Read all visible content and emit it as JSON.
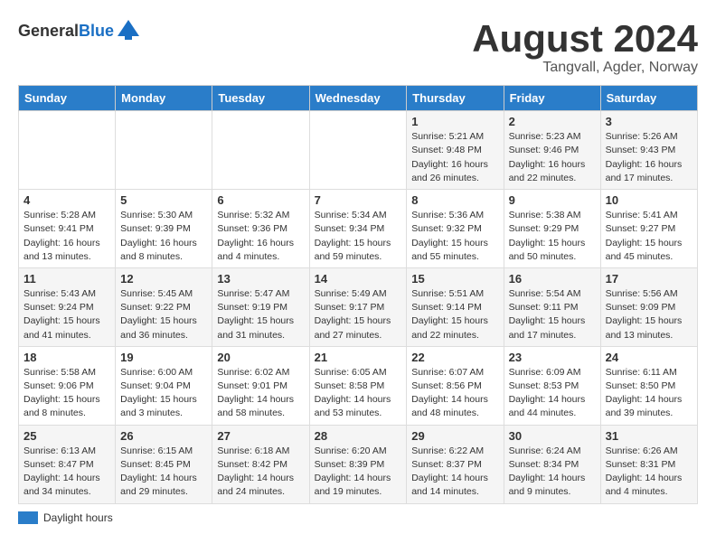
{
  "header": {
    "logo_general": "General",
    "logo_blue": "Blue",
    "title": "August 2024",
    "subtitle": "Tangvall, Agder, Norway"
  },
  "weekdays": [
    "Sunday",
    "Monday",
    "Tuesday",
    "Wednesday",
    "Thursday",
    "Friday",
    "Saturday"
  ],
  "legend": {
    "label": "Daylight hours"
  },
  "weeks": [
    [
      {
        "day": "",
        "info": ""
      },
      {
        "day": "",
        "info": ""
      },
      {
        "day": "",
        "info": ""
      },
      {
        "day": "",
        "info": ""
      },
      {
        "day": "1",
        "info": "Sunrise: 5:21 AM\nSunset: 9:48 PM\nDaylight: 16 hours\nand 26 minutes."
      },
      {
        "day": "2",
        "info": "Sunrise: 5:23 AM\nSunset: 9:46 PM\nDaylight: 16 hours\nand 22 minutes."
      },
      {
        "day": "3",
        "info": "Sunrise: 5:26 AM\nSunset: 9:43 PM\nDaylight: 16 hours\nand 17 minutes."
      }
    ],
    [
      {
        "day": "4",
        "info": "Sunrise: 5:28 AM\nSunset: 9:41 PM\nDaylight: 16 hours\nand 13 minutes."
      },
      {
        "day": "5",
        "info": "Sunrise: 5:30 AM\nSunset: 9:39 PM\nDaylight: 16 hours\nand 8 minutes."
      },
      {
        "day": "6",
        "info": "Sunrise: 5:32 AM\nSunset: 9:36 PM\nDaylight: 16 hours\nand 4 minutes."
      },
      {
        "day": "7",
        "info": "Sunrise: 5:34 AM\nSunset: 9:34 PM\nDaylight: 15 hours\nand 59 minutes."
      },
      {
        "day": "8",
        "info": "Sunrise: 5:36 AM\nSunset: 9:32 PM\nDaylight: 15 hours\nand 55 minutes."
      },
      {
        "day": "9",
        "info": "Sunrise: 5:38 AM\nSunset: 9:29 PM\nDaylight: 15 hours\nand 50 minutes."
      },
      {
        "day": "10",
        "info": "Sunrise: 5:41 AM\nSunset: 9:27 PM\nDaylight: 15 hours\nand 45 minutes."
      }
    ],
    [
      {
        "day": "11",
        "info": "Sunrise: 5:43 AM\nSunset: 9:24 PM\nDaylight: 15 hours\nand 41 minutes."
      },
      {
        "day": "12",
        "info": "Sunrise: 5:45 AM\nSunset: 9:22 PM\nDaylight: 15 hours\nand 36 minutes."
      },
      {
        "day": "13",
        "info": "Sunrise: 5:47 AM\nSunset: 9:19 PM\nDaylight: 15 hours\nand 31 minutes."
      },
      {
        "day": "14",
        "info": "Sunrise: 5:49 AM\nSunset: 9:17 PM\nDaylight: 15 hours\nand 27 minutes."
      },
      {
        "day": "15",
        "info": "Sunrise: 5:51 AM\nSunset: 9:14 PM\nDaylight: 15 hours\nand 22 minutes."
      },
      {
        "day": "16",
        "info": "Sunrise: 5:54 AM\nSunset: 9:11 PM\nDaylight: 15 hours\nand 17 minutes."
      },
      {
        "day": "17",
        "info": "Sunrise: 5:56 AM\nSunset: 9:09 PM\nDaylight: 15 hours\nand 13 minutes."
      }
    ],
    [
      {
        "day": "18",
        "info": "Sunrise: 5:58 AM\nSunset: 9:06 PM\nDaylight: 15 hours\nand 8 minutes."
      },
      {
        "day": "19",
        "info": "Sunrise: 6:00 AM\nSunset: 9:04 PM\nDaylight: 15 hours\nand 3 minutes."
      },
      {
        "day": "20",
        "info": "Sunrise: 6:02 AM\nSunset: 9:01 PM\nDaylight: 14 hours\nand 58 minutes."
      },
      {
        "day": "21",
        "info": "Sunrise: 6:05 AM\nSunset: 8:58 PM\nDaylight: 14 hours\nand 53 minutes."
      },
      {
        "day": "22",
        "info": "Sunrise: 6:07 AM\nSunset: 8:56 PM\nDaylight: 14 hours\nand 48 minutes."
      },
      {
        "day": "23",
        "info": "Sunrise: 6:09 AM\nSunset: 8:53 PM\nDaylight: 14 hours\nand 44 minutes."
      },
      {
        "day": "24",
        "info": "Sunrise: 6:11 AM\nSunset: 8:50 PM\nDaylight: 14 hours\nand 39 minutes."
      }
    ],
    [
      {
        "day": "25",
        "info": "Sunrise: 6:13 AM\nSunset: 8:47 PM\nDaylight: 14 hours\nand 34 minutes."
      },
      {
        "day": "26",
        "info": "Sunrise: 6:15 AM\nSunset: 8:45 PM\nDaylight: 14 hours\nand 29 minutes."
      },
      {
        "day": "27",
        "info": "Sunrise: 6:18 AM\nSunset: 8:42 PM\nDaylight: 14 hours\nand 24 minutes."
      },
      {
        "day": "28",
        "info": "Sunrise: 6:20 AM\nSunset: 8:39 PM\nDaylight: 14 hours\nand 19 minutes."
      },
      {
        "day": "29",
        "info": "Sunrise: 6:22 AM\nSunset: 8:37 PM\nDaylight: 14 hours\nand 14 minutes."
      },
      {
        "day": "30",
        "info": "Sunrise: 6:24 AM\nSunset: 8:34 PM\nDaylight: 14 hours\nand 9 minutes."
      },
      {
        "day": "31",
        "info": "Sunrise: 6:26 AM\nSunset: 8:31 PM\nDaylight: 14 hours\nand 4 minutes."
      }
    ]
  ]
}
